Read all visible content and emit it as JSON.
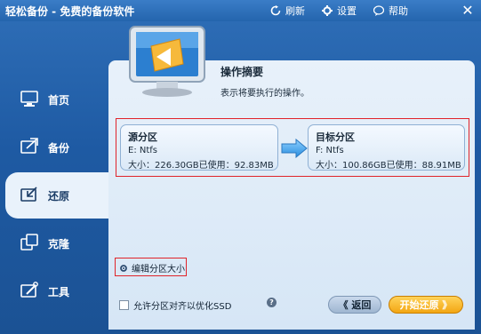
{
  "window": {
    "title": "轻松备份 - 免费的备份软件",
    "toolbar": {
      "refresh": "刷新",
      "settings": "设置",
      "help": "帮助"
    }
  },
  "sidebar": {
    "items": [
      {
        "label": "首页",
        "icon": "monitor-home-icon",
        "active": false
      },
      {
        "label": "备份",
        "icon": "backup-icon",
        "active": false
      },
      {
        "label": "还原",
        "icon": "restore-icon",
        "active": true
      },
      {
        "label": "克隆",
        "icon": "clone-icon",
        "active": false
      },
      {
        "label": "工具",
        "icon": "tools-icon",
        "active": false
      }
    ]
  },
  "summary": {
    "title": "操作摘要",
    "subtitle": "表示将要执行的操作。"
  },
  "source": {
    "title": "源分区",
    "fs": "E: Ntfs",
    "size": "大小：226.30GB已使用：92.83MB"
  },
  "target": {
    "title": "目标分区",
    "fs": "F: Ntfs",
    "size": "大小：100.86GB已使用：88.91MB"
  },
  "actions": {
    "resize": "编辑分区大小",
    "ssd_align": "允许分区对齐以优化SSD",
    "back": "《 返回",
    "start": "开始还原 》"
  },
  "colors": {
    "accent": "#1e5aa3",
    "highlight": "#e0232a",
    "start_button": "#f3a613"
  }
}
